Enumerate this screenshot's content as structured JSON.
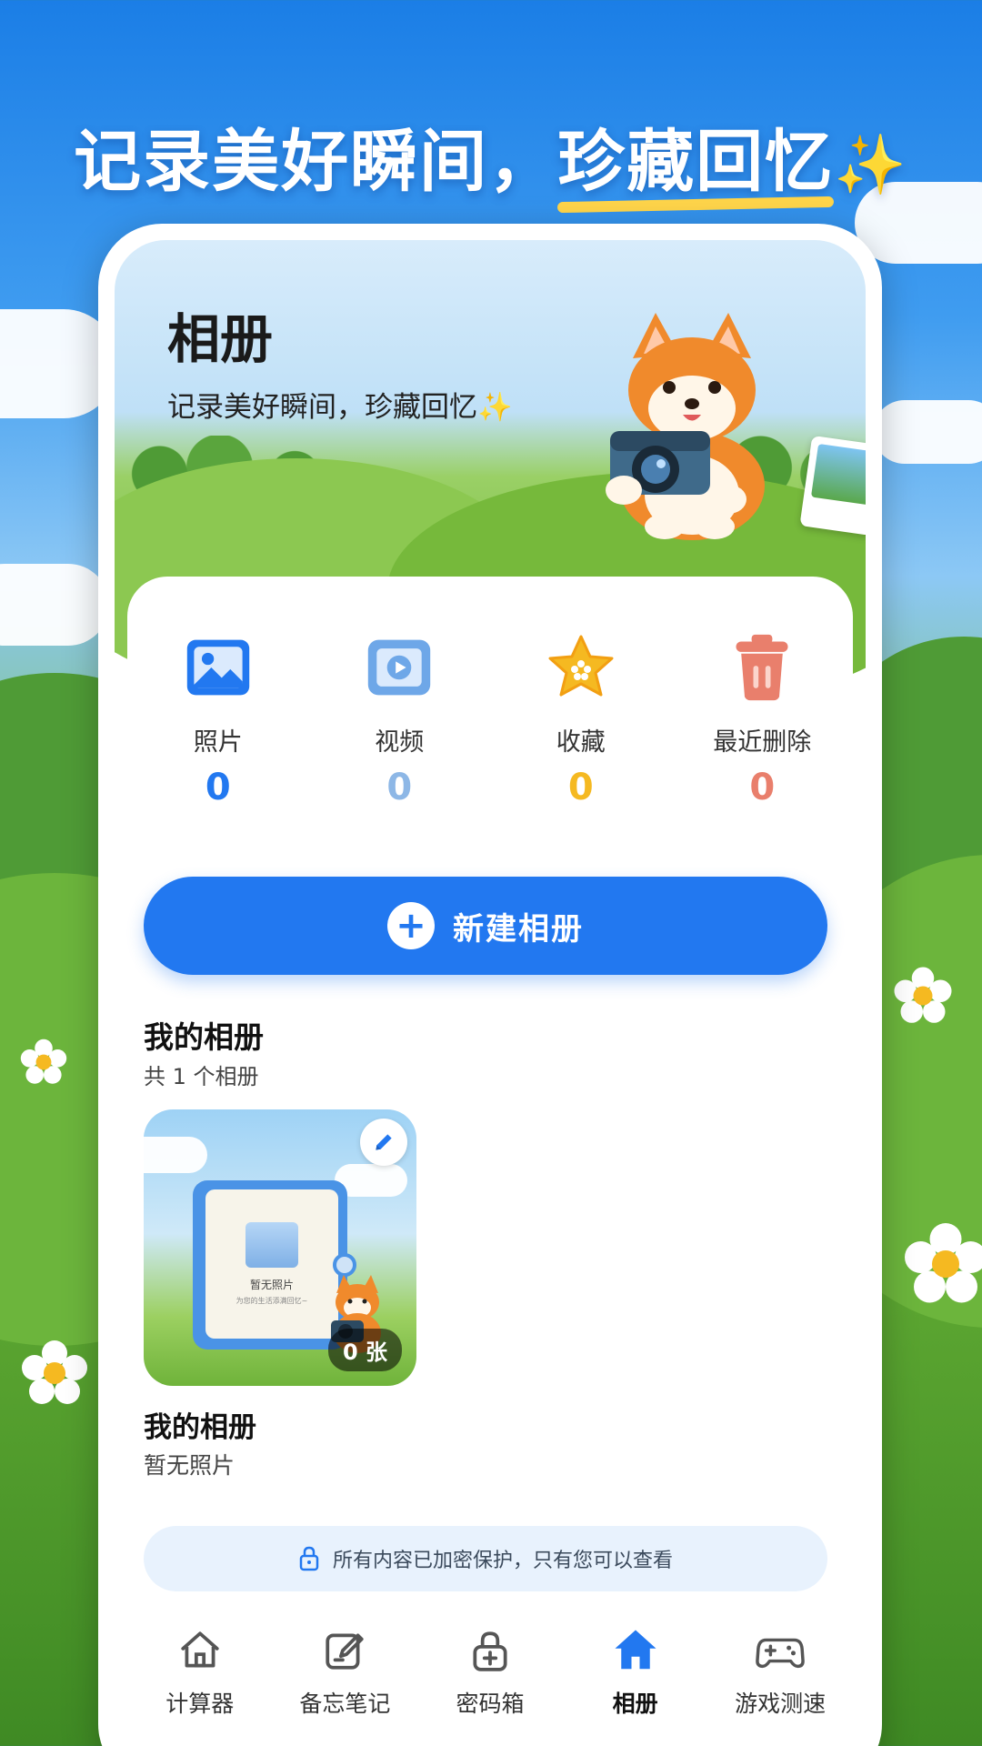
{
  "headline": {
    "part1": "记录美好瞬间，",
    "part2": "珍藏回忆",
    "sparkle": "✨"
  },
  "header": {
    "title": "相册",
    "subtitle": "记录美好瞬间，珍藏回忆",
    "sparkle": "✨"
  },
  "stats": [
    {
      "label": "照片",
      "value": "0",
      "icon": "photo-icon",
      "color": "#2278f0"
    },
    {
      "label": "视频",
      "value": "0",
      "icon": "video-icon",
      "color": "#6ea7e8"
    },
    {
      "label": "收藏",
      "value": "0",
      "icon": "star-icon",
      "color": "#f5b921"
    },
    {
      "label": "最近删除",
      "value": "0",
      "icon": "trash-icon",
      "color": "#e97f6c"
    }
  ],
  "new_album_button": {
    "label": "新建相册",
    "icon": "plus-icon"
  },
  "albums_section": {
    "title": "我的相册",
    "count_text": "共 1 个相册"
  },
  "album": {
    "name": "我的相册",
    "description": "暂无照片",
    "photo_count": "0 张",
    "cover_empty_text": "暂无照片",
    "cover_hint_text": "为您的生活添满回忆~"
  },
  "security_notice": {
    "text": "所有内容已加密保护，只有您可以查看",
    "icon": "lock-icon"
  },
  "tabbar": [
    {
      "label": "计算器",
      "icon": "home-outline-icon",
      "active": false
    },
    {
      "label": "备忘笔记",
      "icon": "note-edit-icon",
      "active": false
    },
    {
      "label": "密码箱",
      "icon": "lock-box-icon",
      "active": false
    },
    {
      "label": "相册",
      "icon": "home-filled-icon",
      "active": true
    },
    {
      "label": "游戏测速",
      "icon": "gamepad-icon",
      "active": false
    }
  ]
}
